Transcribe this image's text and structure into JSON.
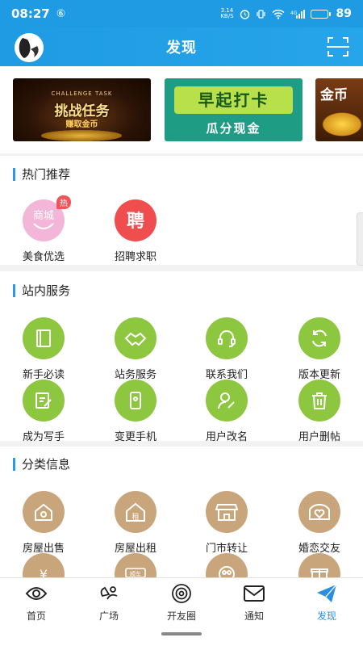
{
  "status_bar": {
    "time": "08:27",
    "app_indicator": "⑥",
    "net_speed_value": "3.14",
    "net_speed_unit": "KB/S",
    "battery_level": 89,
    "battery_text": "89"
  },
  "header": {
    "title": "发现"
  },
  "banners": [
    {
      "sub": "CHALLENGE TASK",
      "main": "挑战任务",
      "line": "赚取金币"
    },
    {
      "main": "早起打卡",
      "line": "瓜分现金"
    },
    {
      "main": "金币"
    }
  ],
  "hot": {
    "title": "热门推荐",
    "items": [
      {
        "label": "美食优选",
        "icon_text": "商城",
        "badge": "热",
        "icon": "mall-icon"
      },
      {
        "label": "招聘求职",
        "icon_text": "聘",
        "icon": "recruit-icon"
      }
    ]
  },
  "services": {
    "title": "站内服务",
    "items": [
      {
        "label": "新手必读",
        "icon": "book-icon"
      },
      {
        "label": "站务服务",
        "icon": "handshake-icon"
      },
      {
        "label": "联系我们",
        "icon": "headset-icon"
      },
      {
        "label": "版本更新",
        "icon": "refresh-icon"
      },
      {
        "label": "成为写手",
        "icon": "edit-icon"
      },
      {
        "label": "变更手机",
        "icon": "phone-icon"
      },
      {
        "label": "用户改名",
        "icon": "user-edit-icon"
      },
      {
        "label": "用户删帖",
        "icon": "trash-icon"
      }
    ]
  },
  "category": {
    "title": "分类信息",
    "items": [
      {
        "label": "房屋出售",
        "icon": "house-sale-icon"
      },
      {
        "label": "房屋出租",
        "icon": "house-rent-icon",
        "icon_text": "租"
      },
      {
        "label": "门市转让",
        "icon": "storefront-icon"
      },
      {
        "label": "婚恋交友",
        "icon": "heart-icon"
      },
      {
        "label": "",
        "icon": "yuan-icon",
        "icon_text": "¥"
      },
      {
        "label": "",
        "icon": "car-icon",
        "icon_text": "顺车"
      },
      {
        "label": "",
        "icon": "people-icon"
      },
      {
        "label": "",
        "icon": "gift-icon"
      }
    ]
  },
  "tabs": [
    {
      "label": "首页",
      "icon": "eye-icon"
    },
    {
      "label": "广场",
      "icon": "square-icon"
    },
    {
      "label": "开友圈",
      "icon": "circle-icon"
    },
    {
      "label": "通知",
      "icon": "mail-icon"
    },
    {
      "label": "发现",
      "icon": "paper-plane-icon",
      "active": true
    }
  ],
  "colors": {
    "primary": "#1e9be3",
    "service_green": "#8dc63f",
    "category_tan": "#c8a57b",
    "hot_badge": "#f0545a",
    "active_tab": "#2a8fe0"
  }
}
